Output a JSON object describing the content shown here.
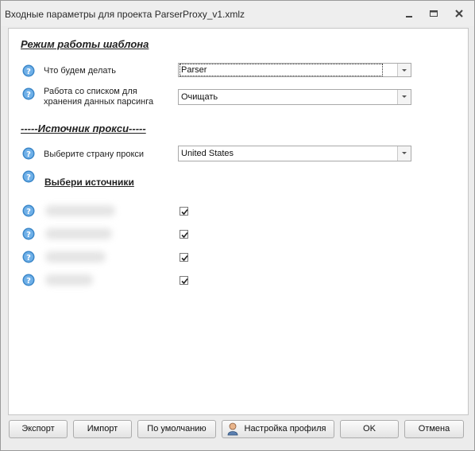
{
  "window": {
    "title": "Входные параметры для проекта ParserProxy_v1.xmlz"
  },
  "sections": {
    "mode_heading": "Режим работы шаблона",
    "proxy_source_heading": "-----Источник прокси-----",
    "choose_sources_heading": "Выбери источники"
  },
  "fields": {
    "what_to_do": {
      "label": "Что будем делать",
      "value": "Parser"
    },
    "list_mode": {
      "label_line1": "Работа со списком для",
      "label_line2": "хранения данных парсинга",
      "value": "Очищать"
    },
    "proxy_country": {
      "label": "Выберите страну прокси",
      "value": "United States"
    }
  },
  "sources": [
    {
      "checked": true
    },
    {
      "checked": true
    },
    {
      "checked": true
    },
    {
      "checked": true
    }
  ],
  "buttons": {
    "export": "Экспорт",
    "import": "Импорт",
    "default": "По умолчанию",
    "profile": "Настройка профиля",
    "ok": "OK",
    "cancel": "Отмена"
  },
  "icons": {
    "help": "help-question-icon",
    "profile": "user-avatar-icon",
    "minimize": "minimize-icon",
    "restore": "restore-icon",
    "close": "close-icon"
  },
  "colors": {
    "help_icon": "#3a86c8",
    "window_bg": "#ececec",
    "panel_bg": "#ffffff"
  }
}
